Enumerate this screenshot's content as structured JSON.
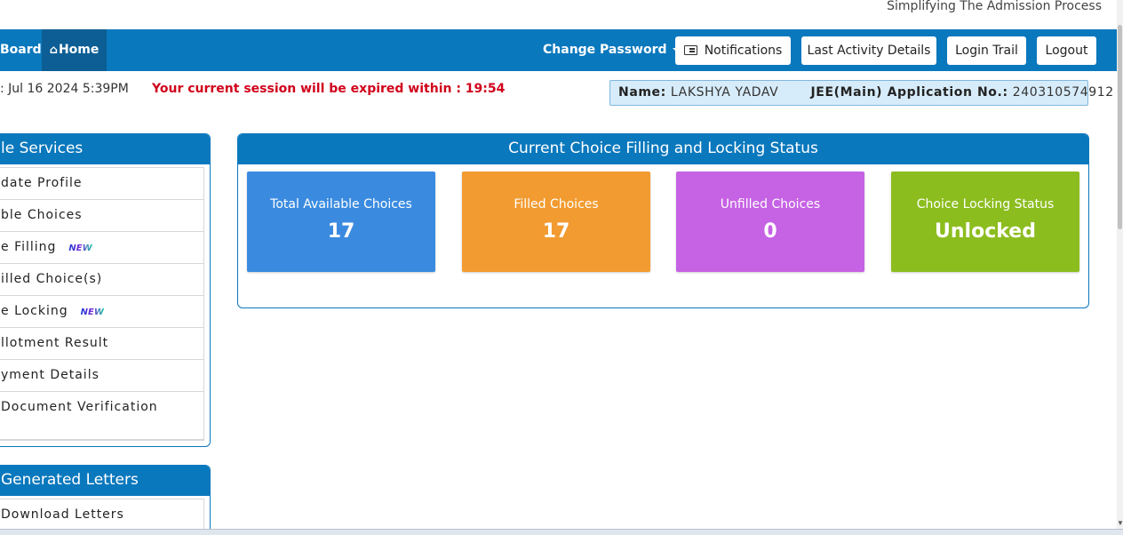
{
  "header": {
    "tagline": "Simplifying The Admission Process"
  },
  "navbar": {
    "brand": "Board",
    "home": "Home",
    "change_password": "Change Password",
    "buttons": {
      "notifications": "Notifications",
      "last_activity": "Last Activity Details",
      "login_trail": "Login Trail",
      "logout": "Logout"
    },
    "color": "#0a78bd"
  },
  "info": {
    "datetime": ": Jul 16 2024 5:39PM",
    "session_warning": "Your current session will be expired within : 19:54",
    "name_label": "Name:",
    "name_value": "LAKSHYA YADAV",
    "app_label": "JEE(Main) Application No.:",
    "app_value": "240310574912"
  },
  "sidebar": {
    "services_title": "le Services",
    "items": [
      {
        "label": "date Profile"
      },
      {
        "label": "ble Choices"
      },
      {
        "label": "e Filling",
        "badge": "NEW"
      },
      {
        "label": "illed Choice(s)"
      },
      {
        "label": "e Locking",
        "badge": "NEW"
      },
      {
        "label": "llotment Result"
      },
      {
        "label": "yment Details"
      },
      {
        "label": "Document Verification"
      }
    ],
    "letters_title": " Generated Letters",
    "letters_items": [
      {
        "label": "Download Letters"
      }
    ]
  },
  "status": {
    "title": "Current Choice Filling and Locking Status",
    "cards": [
      {
        "label": "Total Available Choices",
        "value": "17",
        "color": "#3a8be0"
      },
      {
        "label": "Filled Choices",
        "value": "17",
        "color": "#f29b30"
      },
      {
        "label": "Unfilled Choices",
        "value": "0",
        "color": "#c662e4"
      },
      {
        "label": "Choice Locking Status",
        "value": "Unlocked",
        "color": "#8cbd1f"
      }
    ]
  },
  "icons": {
    "home": "home-icon",
    "notifications": "newspaper-icon",
    "dropdown": "caret-down-icon"
  }
}
